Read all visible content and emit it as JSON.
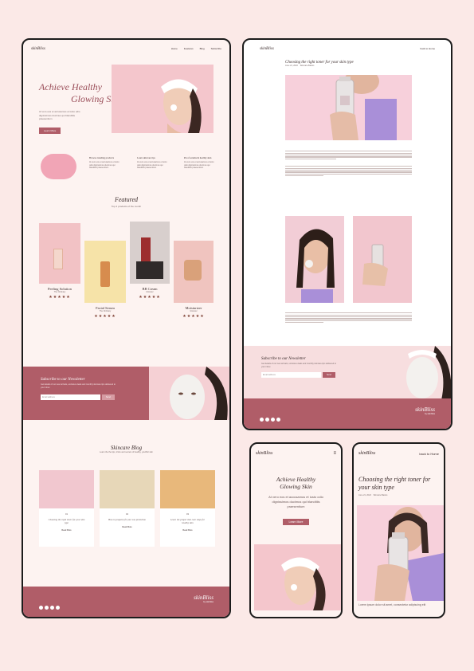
{
  "brand": "skinBliss",
  "brand_footer": "skinBliss",
  "brand_tagline": "by skinbliss",
  "nav": {
    "items": [
      "Home",
      "Features",
      "Blog",
      "Subscribe"
    ],
    "back": "back to Home",
    "mobile_back": "back to Home"
  },
  "hero": {
    "title_line1": "Achieve Healthy",
    "title_line2": "Glowing Skin",
    "text": "At vero eos et accusamus et iusto odio dignissimos ducimus qui blanditiis praesentium",
    "button": "Learn More"
  },
  "features": [
    {
      "title": "Browse trending products",
      "text": "At vero eos et accusamus et iusto odio dignissimos ducimus qui blanditiis praesentium"
    },
    {
      "title": "Learn skincare tips",
      "text": "At vero eos et accusamus et iusto odio dignissimos ducimus qui blanditiis praesentium"
    },
    {
      "title": "Proof serums & healthy skin",
      "text": "At vero eos et accusamus et iusto odio dignissimos ducimus qui blanditiis praesentium"
    }
  ],
  "featured": {
    "title": "Featured",
    "subtitle": "Top 4 products of the month",
    "products": [
      {
        "name": "Peeling Solution",
        "sub": "The Ordinary",
        "rating": "★★★★★"
      },
      {
        "name": "Facial Serum",
        "sub": "The Ordinary",
        "rating": "★★★★★"
      },
      {
        "name": "BB Cream",
        "sub": "Glossier",
        "rating": "★★★★★"
      },
      {
        "name": "Moisturizer",
        "sub": "Glossier",
        "rating": "★★★★★"
      }
    ]
  },
  "newsletter": {
    "title": "Subscribe to our Newsletter",
    "text": "Get details of our new arrivals, exclusive deals and monthly skincare tips delivered to your inbox",
    "placeholder": "Email address",
    "button": "Send"
  },
  "blog": {
    "title": "Skincare Blog",
    "subtitle": "Learn the the tips, tricks and secrets of healthy, youthful skin",
    "posts": [
      {
        "num": "01",
        "title": "Choosing the right toner for your skin type",
        "link": "Read More"
      },
      {
        "num": "02",
        "title": "How to properly fit your sun protection",
        "link": "Read More"
      },
      {
        "num": "03",
        "title": "Learn the proper skin care steps for healthy skin",
        "link": "Read More"
      }
    ]
  },
  "article": {
    "title": "Choosing the right toner for your skin type",
    "date": "June 21, 2022",
    "author": "Skincare Basics",
    "para": "Lorem ipsum dolor sit amet, consectetur adipiscing elit, sed do eiusmod tempor incididunt ut labore et dolore magna aliqua."
  },
  "mobile_hero": {
    "title_line1": "Achieve Healthy",
    "title_line2": "Glowing Skin",
    "text": "At vero eos et accusamus et iusto odio dignissimos ducimus qui blanditiis praesentium",
    "button": "Learn More"
  },
  "mobile_article": {
    "title": "Choosing the right toner for your skin type",
    "date": "June 21, 2022",
    "author": "Skincare Basics",
    "para": "Lorem ipsum dolor sit amet, consectetur adipiscing elit"
  },
  "colors": {
    "accent": "#b05d68",
    "page_bg": "#fbe9e7",
    "pink": "#f2c6cc"
  }
}
